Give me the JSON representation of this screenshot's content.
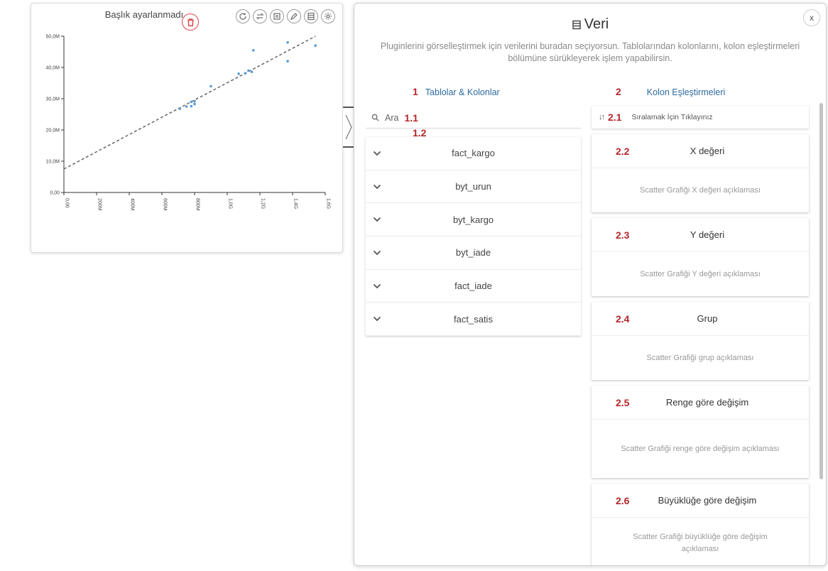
{
  "chart_card": {
    "title": "Başlık ayarlanmadı",
    "toolbar": [
      "refresh-icon",
      "swap-icon",
      "frame-icon",
      "edit-icon",
      "table-icon",
      "settings-icon"
    ],
    "delete_icon": "trash-icon"
  },
  "chart_data": {
    "type": "scatter",
    "title": "",
    "xlabel": "",
    "ylabel": "",
    "xlim": [
      0,
      1.6
    ],
    "ylim": [
      0,
      50
    ],
    "x_tick_labels": [
      "0,00",
      "200M",
      "400M",
      "600M",
      "800M",
      "1,0G",
      "1,2G",
      "1,4G",
      "1,6G"
    ],
    "y_tick_labels": [
      "0,00",
      "10,0M",
      "20,0M",
      "30,0M",
      "40,0M",
      "50,0M"
    ],
    "grid": false,
    "series": [
      {
        "points": [
          [
            0.71,
            26.8
          ],
          [
            0.75,
            27.5
          ],
          [
            0.78,
            27.6
          ],
          [
            0.8,
            28.3
          ],
          [
            0.78,
            29.0
          ],
          [
            0.8,
            29.2
          ],
          [
            0.9,
            34.0
          ],
          [
            1.07,
            38.0
          ],
          [
            1.11,
            38.1
          ],
          [
            1.15,
            38.6
          ],
          [
            1.13,
            39.0
          ],
          [
            1.16,
            45.5
          ],
          [
            1.37,
            42.0
          ],
          [
            1.37,
            48.0
          ],
          [
            1.54,
            47.0
          ]
        ]
      }
    ],
    "trendline": {
      "style": "dashed",
      "from": [
        0,
        7.5
      ],
      "to": [
        1.54,
        50.0
      ]
    }
  },
  "panel": {
    "close_label": "x",
    "title": "Veri",
    "description": "Pluginlerini görselleştirmek için verilerini buradan seçiyorsun. Tablolarından kolonlarını, kolon eşleştirmeleri bölümüne sürükleyerek işlem yapabilirsin.",
    "tables_section": {
      "number": "1",
      "label": "Tablolar & Kolonlar",
      "search_placeholder": "Ara",
      "search_number": "1.1",
      "list_number": "1.2",
      "tables": [
        "fact_kargo",
        "byt_urun",
        "byt_kargo",
        "byt_iade",
        "fact_iade",
        "fact_satis"
      ]
    },
    "mapping_section": {
      "number": "2",
      "label": "Kolon Eşleştirmeleri",
      "sort_number": "2.1",
      "sort_label": "Sıralamak İçin Tıklayınız",
      "sort_icon": "↓↑",
      "cards": [
        {
          "number": "2.2",
          "name": "X değeri",
          "desc": "Scatter Grafiği X değeri açıklaması"
        },
        {
          "number": "2.3",
          "name": "Y değeri",
          "desc": "Scatter Grafiği Y değeri açıklaması"
        },
        {
          "number": "2.4",
          "name": "Grup",
          "desc": "Scatter Grafiği grup açıklaması"
        },
        {
          "number": "2.5",
          "name": "Renge göre değişim",
          "desc": "Scatter Grafiği renge göre değişim açıklaması"
        },
        {
          "number": "2.6",
          "name": "Büyüklüğe göre değişim",
          "desc": "Scatter Grafiği büyüklüğe göre değişim açıklaması"
        }
      ]
    }
  },
  "colors": {
    "accent_blue": "#2d6aa1",
    "number_red": "#b5252a",
    "point_blue": "#5b9bd5",
    "delete_red": "#e0454b"
  }
}
